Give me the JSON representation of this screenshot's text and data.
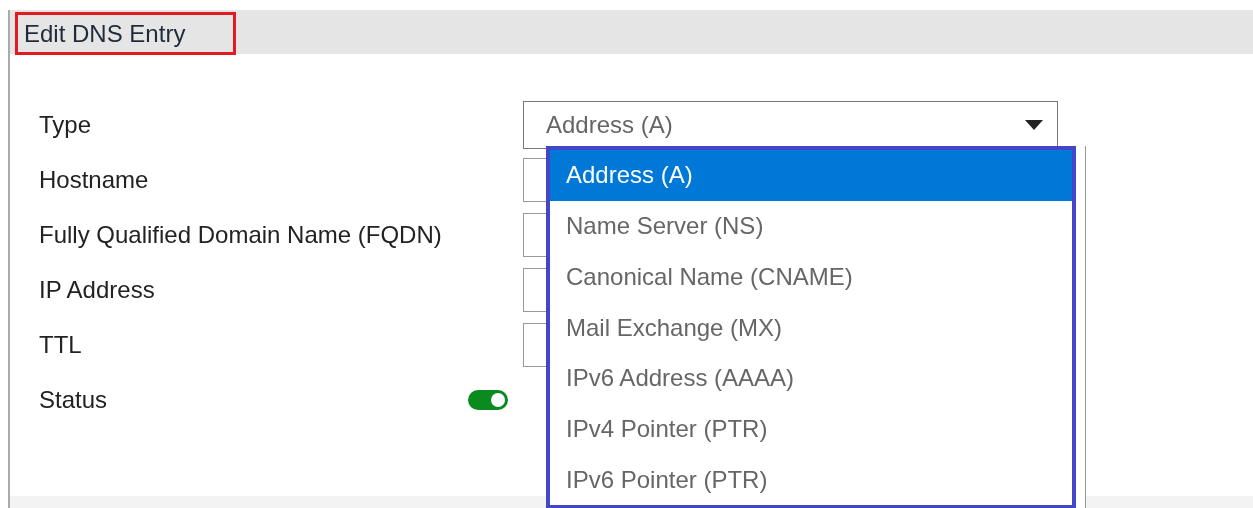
{
  "dialog": {
    "title": "Edit DNS Entry"
  },
  "fields": [
    {
      "label": "Type",
      "kind": "select",
      "value": "Address (A)"
    },
    {
      "label": "Hostname",
      "kind": "text"
    },
    {
      "label": "Fully Qualified Domain Name (FQDN)",
      "kind": "text"
    },
    {
      "label": "IP Address",
      "kind": "text"
    },
    {
      "label": "TTL",
      "kind": "text"
    },
    {
      "label": "Status",
      "kind": "toggle",
      "on": true
    }
  ],
  "dropdown": {
    "options": [
      {
        "label": "Address (A)",
        "selected": true
      },
      {
        "label": "Name Server (NS)",
        "selected": false
      },
      {
        "label": "Canonical Name (CNAME)",
        "selected": false
      },
      {
        "label": "Mail Exchange (MX)",
        "selected": false
      },
      {
        "label": "IPv6 Address (AAAA)",
        "selected": false
      },
      {
        "label": "IPv4 Pointer (PTR)",
        "selected": false
      },
      {
        "label": "IPv6 Pointer (PTR)",
        "selected": false
      }
    ]
  }
}
